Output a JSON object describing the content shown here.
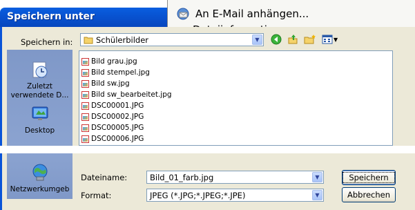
{
  "background_menu": {
    "item_email": "An E-Mail anhängen...",
    "item_info_partial": "Dateiinformationen"
  },
  "dialog": {
    "title": "Speichern unter",
    "save_in_label": "Speichern in:",
    "save_in_value": "Schülerbilder",
    "places": [
      {
        "label": "Zuletzt verwendete D...",
        "icon": "recent-documents-icon"
      },
      {
        "label": "Desktop",
        "icon": "desktop-icon"
      },
      {
        "label": "Netzwerkumgeb",
        "icon": "network-places-icon"
      }
    ],
    "files": [
      "Bild grau.jpg",
      "Bild stempel.jpg",
      "Bild sw.jpg",
      "Bild sw_bearbeitet.jpg",
      "DSC00001.JPG",
      "DSC00002.JPG",
      "DSC00005.JPG",
      "DSC00006.JPG"
    ],
    "filename_label": "Dateiname:",
    "filename_value": "Bild_01_farb.jpg",
    "format_label": "Format:",
    "format_value": "JPEG (*.JPG;*.JPEG;*.JPE)",
    "save_button": "Speichern",
    "cancel_button": "Abbrechen"
  },
  "colors": {
    "titlebar": "#0853d2",
    "dialog_bg": "#ece9d8",
    "places_bar": "#8ba3d0"
  }
}
